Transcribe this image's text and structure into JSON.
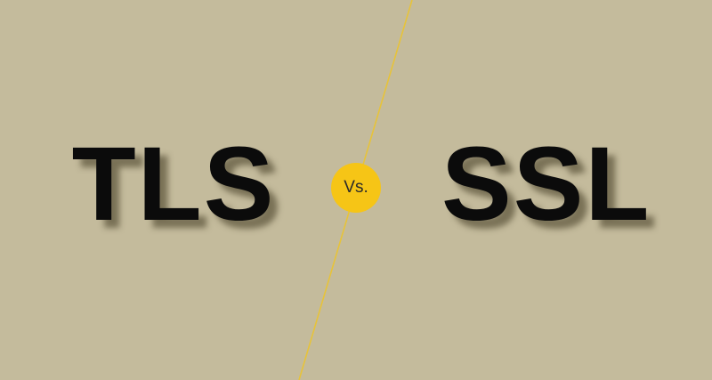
{
  "colors": {
    "background": "#c4bb9c",
    "accent": "#f6c516",
    "text": "#0b0b0b"
  },
  "left_term": "TLS",
  "separator": "Vs.",
  "right_term": "SSL"
}
